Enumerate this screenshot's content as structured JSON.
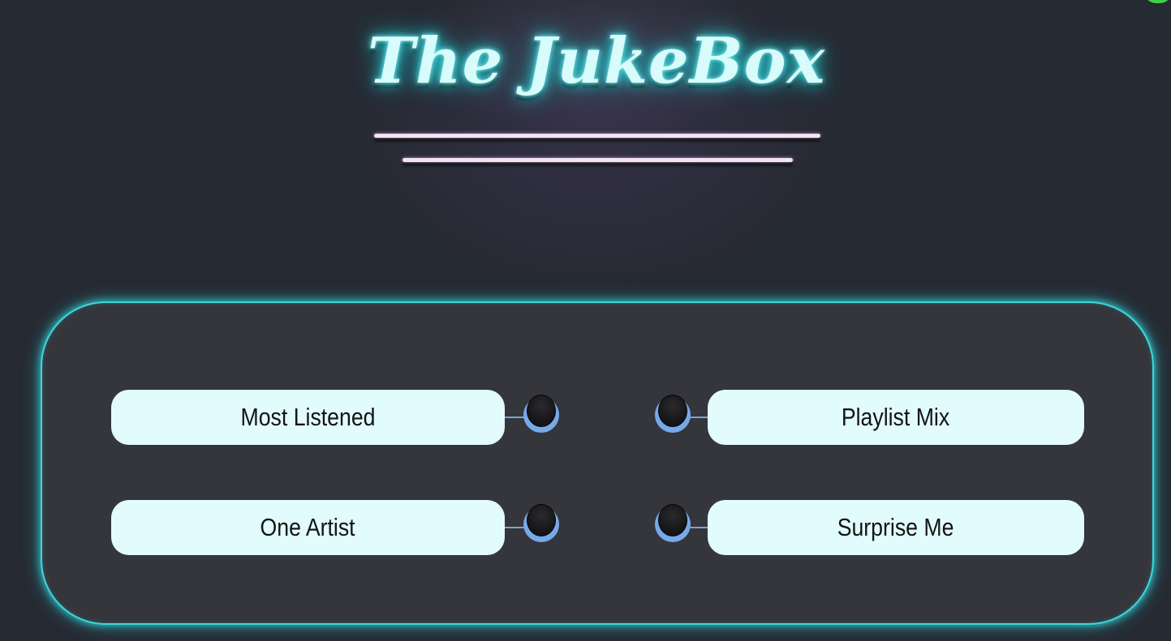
{
  "header": {
    "title": "The JukeBox"
  },
  "options": {
    "most_listened": "Most Listened",
    "one_artist": "One Artist",
    "playlist_mix": "Playlist Mix",
    "surprise_me": "Surprise Me"
  },
  "colors": {
    "background": "#262a33",
    "panel": "#35363b",
    "panel_glow": "#3cd6da",
    "title_glow": "#2ed6dc",
    "button_fill": "#e2fbfd",
    "knob_ring": "#76a9ea",
    "underline": "#f3e3f6"
  },
  "icons": {
    "knob": "toggle-knob-icon"
  }
}
